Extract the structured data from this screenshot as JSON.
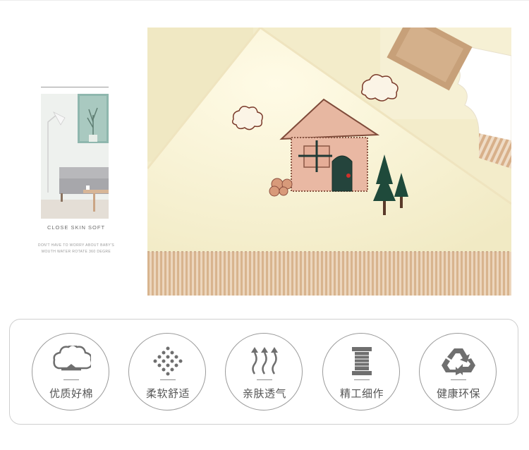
{
  "thumbnail": {
    "caption": "CLOSE SKIN SOFT",
    "subcaption_line1": "DON'T HAVE TO WORRY ABOUT BABY'S",
    "subcaption_line2": "MOUTH WATER ROTATE 360 DEGRE"
  },
  "features": [
    {
      "label": "优质好棉",
      "icon": "cotton-boll-icon"
    },
    {
      "label": "柔软舒适",
      "icon": "dots-diamond-icon"
    },
    {
      "label": "亲肤透气",
      "icon": "breathable-arrows-icon"
    },
    {
      "label": "精工细作",
      "icon": "thread-spool-icon"
    },
    {
      "label": "健康环保",
      "icon": "recycle-icon"
    }
  ],
  "colors": {
    "fabric": "#fbf6d8",
    "stripe_tan": "#d7b48d",
    "border": "#cfcfcf",
    "icon_gray": "#6f6f6f",
    "label_gray": "#555555"
  }
}
